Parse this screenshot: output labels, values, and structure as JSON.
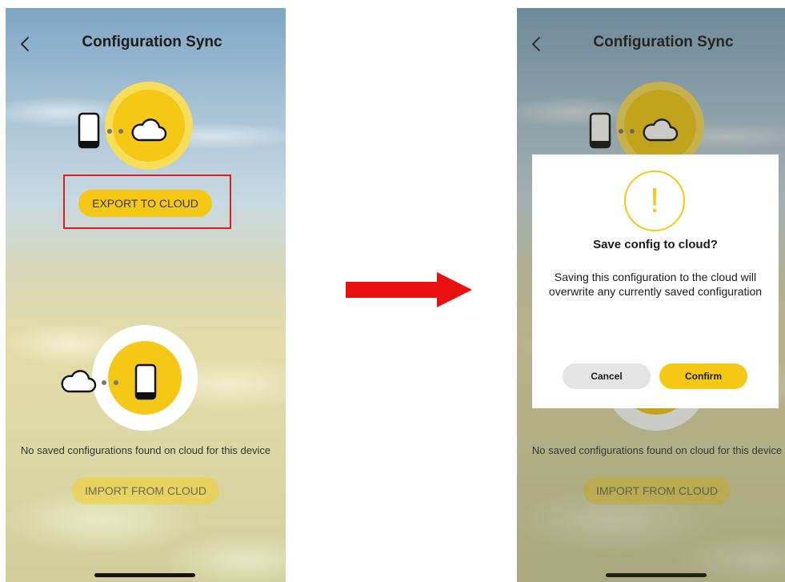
{
  "header": {
    "title": "Configuration Sync"
  },
  "export_section": {
    "button_label": "EXPORT TO CLOUD"
  },
  "import_section": {
    "empty_text": "No saved configurations found on cloud for this device",
    "button_label": "IMPORT FROM CLOUD"
  },
  "dialog": {
    "title": "Save config to cloud?",
    "message": "Saving this configuration to the cloud will\noverwrite any currently saved configuration",
    "cancel_label": "Cancel",
    "confirm_label": "Confirm",
    "warning_symbol": "!"
  },
  "colors": {
    "accent": "#f4c814",
    "highlight_box": "#d92020",
    "arrow": "#e81010"
  },
  "icons": [
    "back-chevron-icon",
    "phone-icon",
    "cloud-icon",
    "warning-icon",
    "arrow-right-icon"
  ]
}
